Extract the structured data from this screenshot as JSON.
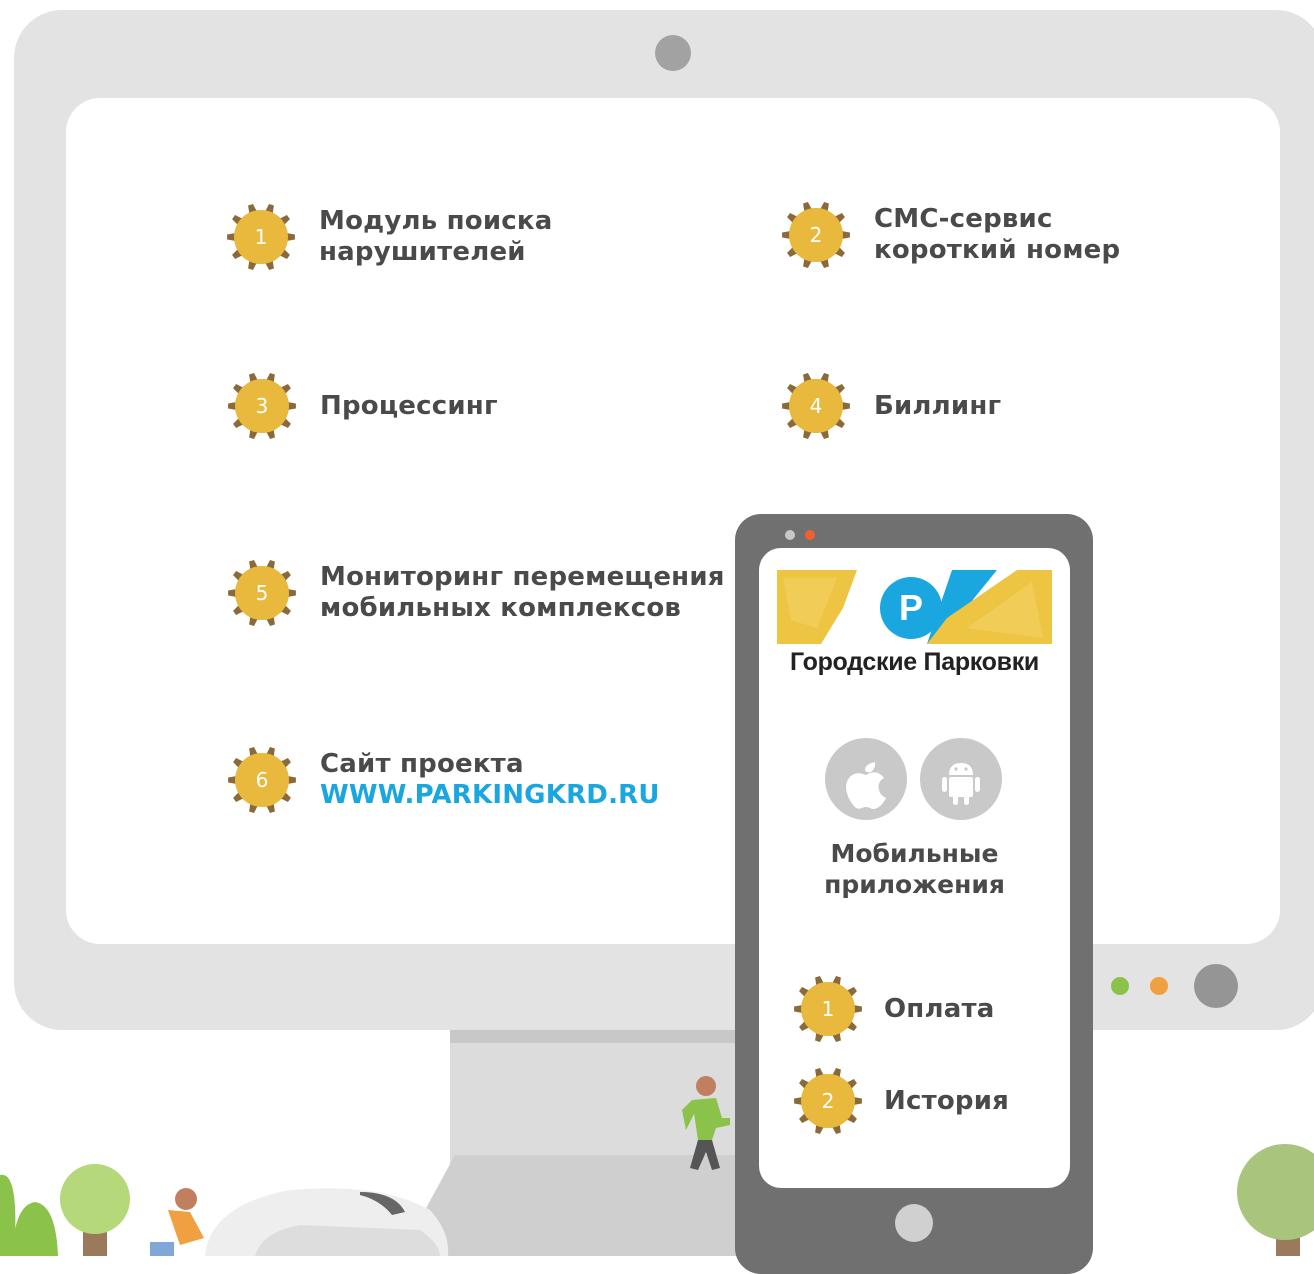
{
  "features": [
    {
      "num": "1",
      "lines": [
        "Модуль поиска",
        "нарушителей"
      ]
    },
    {
      "num": "2",
      "lines": [
        "СМС-сервис",
        "короткий номер"
      ]
    },
    {
      "num": "3",
      "lines": [
        "Процессинг"
      ]
    },
    {
      "num": "4",
      "lines": [
        "Биллинг"
      ]
    },
    {
      "num": "5",
      "lines": [
        "Мониторинг перемещения",
        "мобильных комплексов"
      ]
    },
    {
      "num": "6",
      "lines": [
        "Сайт проекта"
      ],
      "link": "WWW.PARKINGKRD.RU"
    }
  ],
  "phone": {
    "brand": "Городские Парковки",
    "logo_letter": "P",
    "apps_label": [
      "Мобильные",
      "приложения"
    ],
    "platform_icons": [
      "apple-icon",
      "android-icon"
    ],
    "items": [
      {
        "num": "1",
        "label": "Оплата"
      },
      {
        "num": "2",
        "label": "История"
      }
    ]
  },
  "colors": {
    "monitor": "#e3e3e3",
    "gear": "#e8b93c",
    "gear_outline": "#8a6a3a",
    "text": "#4a4a4a",
    "link": "#1aa6df",
    "logo_yellow": "#eec443",
    "logo_blue": "#1aa6df",
    "indicator_green": "#8bc34a",
    "indicator_orange": "#f0a040"
  }
}
